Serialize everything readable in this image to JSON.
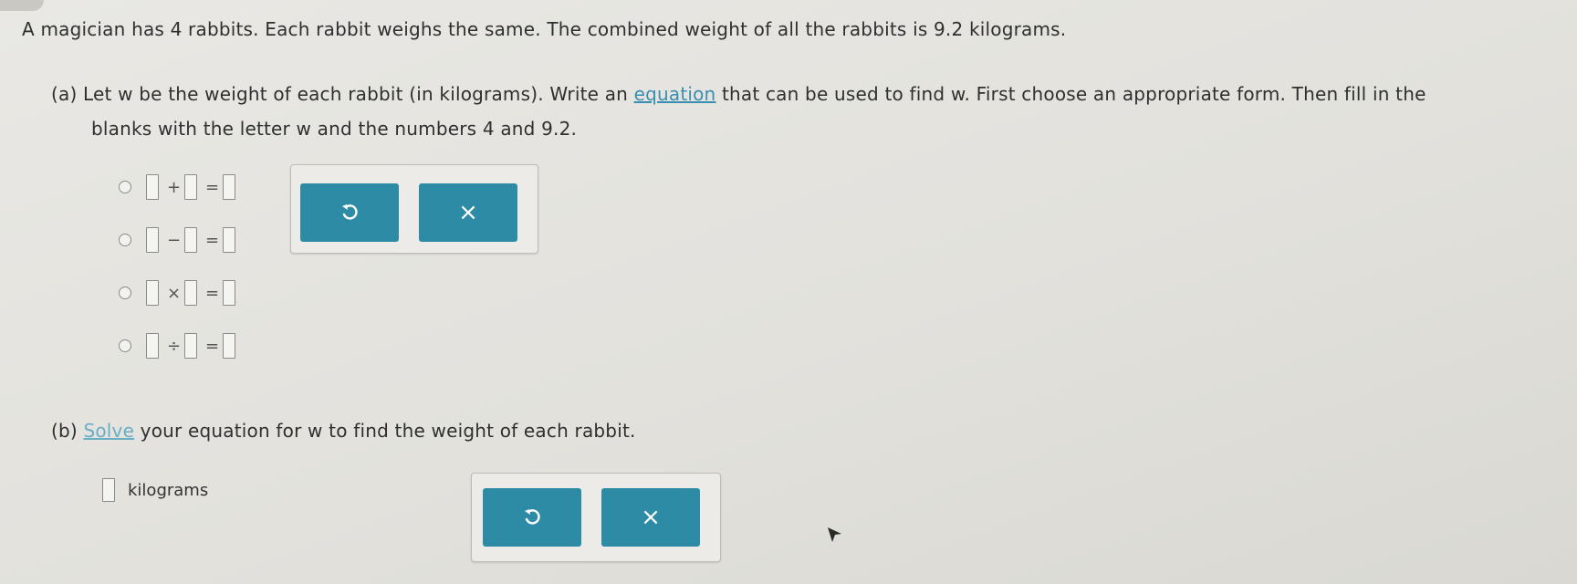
{
  "problem": {
    "statement": "A magician has 4 rabbits. Each rabbit weighs the same. The combined weight of all the rabbits is 9.2 kilograms."
  },
  "part_a": {
    "label": "(a)",
    "text_before_link": "Let w be the weight of each rabbit (in kilograms). Write an ",
    "link_text": "equation",
    "text_after_link": " that can be used to find w. First choose an appropriate form. Then fill in the",
    "text_line2": "blanks with the letter w and the numbers 4 and 9.2.",
    "forms": [
      {
        "operator": "+",
        "equals": "="
      },
      {
        "operator": "−",
        "equals": "="
      },
      {
        "operator": "×",
        "equals": "="
      },
      {
        "operator": "÷",
        "equals": "="
      }
    ],
    "clear_symbol": "×"
  },
  "part_b": {
    "label": "(b)",
    "link_text": "Solve",
    "text_after_link": " your equation for w to find the weight of each rabbit.",
    "unit": "kilograms",
    "clear_symbol": "×"
  },
  "colors": {
    "accent": "#2e8ba6",
    "link": "#3a8fb0",
    "background": "#e6e5e0"
  },
  "icons": [
    "undo-icon",
    "clear-icon",
    "mouse-cursor-icon"
  ]
}
